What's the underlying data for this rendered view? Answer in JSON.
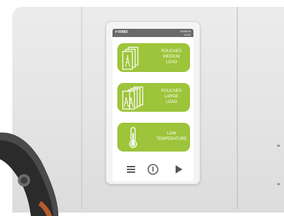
{
  "status_bar": {
    "device_id": "# 00083",
    "date": "10/08/16",
    "time": "10:51"
  },
  "programs": [
    {
      "icon": "pouch-stack-icon",
      "line1": "POUCHES",
      "line2": "Medium",
      "line3": "Load"
    },
    {
      "icon": "pouch-stack-large-icon",
      "line1": "POUCHES",
      "line2": "Large",
      "line3": "Load"
    },
    {
      "icon": "thermometer-icon",
      "line1": "LOW",
      "line2": "TEMPERATURE",
      "line3": ""
    }
  ],
  "nav": {
    "menu_icon": "menu-icon",
    "power_icon": "power-icon",
    "play_icon": "play-icon"
  },
  "colors": {
    "accent": "#9dc43a",
    "status_bar": "#6a6a6a",
    "icon_gray": "#555555"
  }
}
